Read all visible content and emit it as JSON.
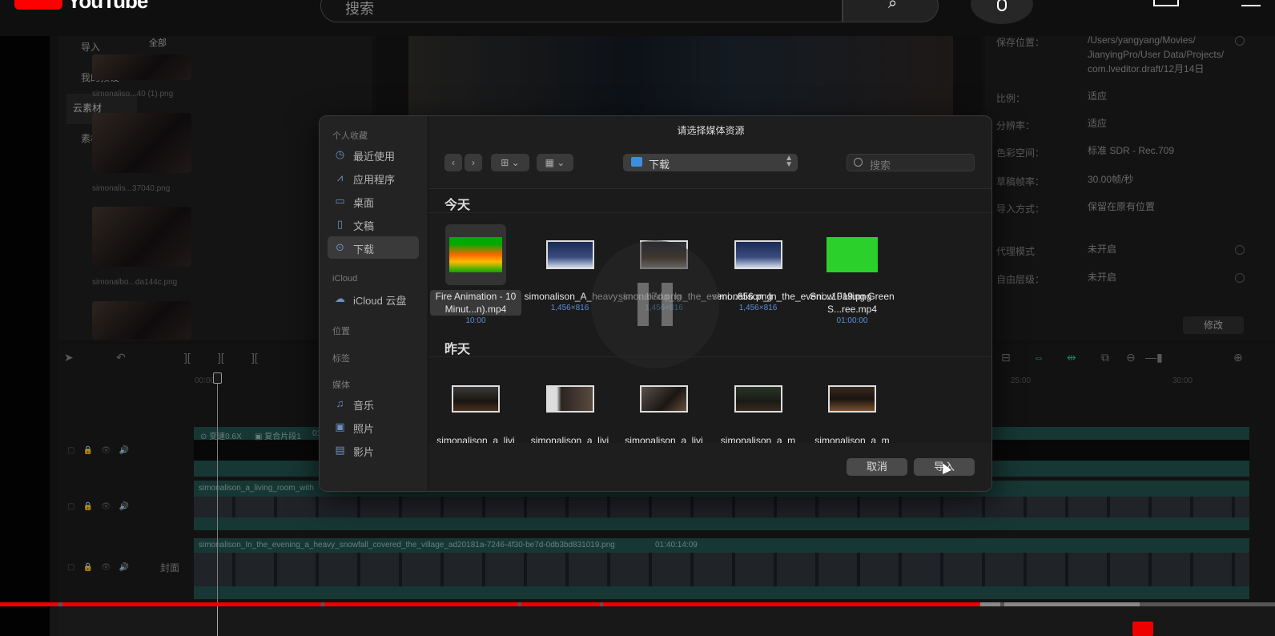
{
  "youtube": {
    "brand": "YouTube",
    "search_placeholder": "搜索"
  },
  "library": {
    "nav": [
      "导入",
      "我的预设",
      "云素材",
      "素材库"
    ],
    "active_nav": "云素材",
    "header": "全部",
    "thumbs": [
      {
        "caption": "simonaliso...40 (1).png"
      },
      {
        "caption": "simonalis...37040.png"
      },
      {
        "caption": "simonalbo...da144c.png"
      }
    ]
  },
  "properties": {
    "rows": [
      {
        "label": "保存位置：",
        "value": "/Users/yangyang/Movies/ JianyingPro/User Data/Projects/ com.lveditor.draft/12月14日"
      },
      {
        "label": "比例：",
        "value": "适应"
      },
      {
        "label": "分辨率：",
        "value": "适应"
      },
      {
        "label": "色彩空间：",
        "value": "标准 SDR - Rec.709"
      },
      {
        "label": "草稿帧率：",
        "value": "30.00帧/秒"
      },
      {
        "label": "导入方式：",
        "value": "保留在原有位置"
      },
      {
        "label": "代理模式",
        "value": "未开启"
      },
      {
        "label": "自由层级：",
        "value": "未开启"
      }
    ],
    "edit_button": "修改"
  },
  "timeline": {
    "ruler": [
      "00:00",
      "25:00",
      "30:00"
    ],
    "clip1_label": "变速0.6X",
    "clip1_group": "复合片段1",
    "clip1_time": "01",
    "clip2_label": "simonalison_a_living_room_with",
    "clip3_label": "simonalison_In_the_evening_a_heavy_snowfall_covered_the_village_ad20181a-7246-4f30-be7d-0db3bd831019.png",
    "clip3_time": "01:40:14:09",
    "cover_label": "封面"
  },
  "dialog": {
    "title": "请选择媒体资源",
    "sidebar": {
      "favorites_header": "个人收藏",
      "favorites": [
        {
          "label": "最近使用",
          "icon": "clock-icon"
        },
        {
          "label": "应用程序",
          "icon": "apps-icon"
        },
        {
          "label": "桌面",
          "icon": "desktop-icon"
        },
        {
          "label": "文稿",
          "icon": "document-icon"
        },
        {
          "label": "下载",
          "icon": "download-icon",
          "active": true
        }
      ],
      "icloud_header": "iCloud",
      "icloud": [
        {
          "label": "iCloud 云盘",
          "icon": "cloud-icon"
        }
      ],
      "locations_header": "位置",
      "tags_header": "标签",
      "media_header": "媒体",
      "media": [
        {
          "label": "音乐",
          "icon": "music-icon"
        },
        {
          "label": "照片",
          "icon": "photo-icon"
        },
        {
          "label": "影片",
          "icon": "film-icon"
        }
      ]
    },
    "location": "下载",
    "search_placeholder": "搜索",
    "groups": [
      {
        "header": "今天",
        "files": [
          {
            "name": "Fire Animation - 10 Minut...n).mp4",
            "meta": "10:00",
            "kind": "fire",
            "selected": true
          },
          {
            "name": "simonalison_A_heavy_sno...b7d.png",
            "meta": "1,456×816",
            "kind": "snow"
          },
          {
            "name": "simonalison_In_the_eveni...656.png",
            "meta": "1,456×816",
            "kind": "village"
          },
          {
            "name": "simonalison_In_the_eveni...1019.png",
            "meta": "1,456×816",
            "kind": "snow"
          },
          {
            "name": "Snow Falling Green S...ree.mp4",
            "meta": "01:00:00",
            "kind": "green"
          }
        ]
      },
      {
        "header": "昨天",
        "files": [
          {
            "name": "simonalison_a_livi",
            "kind": "room"
          },
          {
            "name": "simonalison_a_livi",
            "kind": "room2"
          },
          {
            "name": "simonalison_a_livi",
            "kind": "room3"
          },
          {
            "name": "simonalison_a_m",
            "kind": "room4"
          },
          {
            "name": "simonalison_a_m",
            "kind": "room5"
          }
        ]
      }
    ],
    "cancel_label": "取消",
    "import_label": "导入"
  },
  "colors": {
    "accent_blue": "#3e8ee0",
    "youtube_red": "#ff0000",
    "clip_teal": "#1f4a46"
  }
}
